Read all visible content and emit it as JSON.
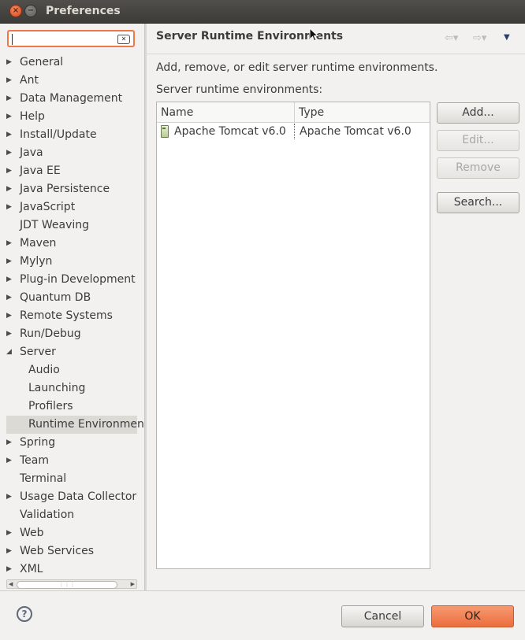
{
  "window": {
    "title": "Preferences"
  },
  "sidebar": {
    "search_placeholder": "",
    "items": [
      {
        "label": "General",
        "expander": "▶"
      },
      {
        "label": "Ant",
        "expander": "▶"
      },
      {
        "label": "Data Management",
        "expander": "▶"
      },
      {
        "label": "Help",
        "expander": "▶"
      },
      {
        "label": "Install/Update",
        "expander": "▶"
      },
      {
        "label": "Java",
        "expander": "▶"
      },
      {
        "label": "Java EE",
        "expander": "▶"
      },
      {
        "label": "Java Persistence",
        "expander": "▶"
      },
      {
        "label": "JavaScript",
        "expander": "▶"
      },
      {
        "label": "JDT Weaving",
        "expander": ""
      },
      {
        "label": "Maven",
        "expander": "▶"
      },
      {
        "label": "Mylyn",
        "expander": "▶"
      },
      {
        "label": "Plug-in Development",
        "expander": "▶"
      },
      {
        "label": "Quantum DB",
        "expander": "▶"
      },
      {
        "label": "Remote Systems",
        "expander": "▶"
      },
      {
        "label": "Run/Debug",
        "expander": "▶"
      },
      {
        "label": "Server",
        "expander": "◢"
      },
      {
        "label": "Audio",
        "expander": "",
        "child": true
      },
      {
        "label": "Launching",
        "expander": "",
        "child": true
      },
      {
        "label": "Profilers",
        "expander": "",
        "child": true
      },
      {
        "label": "Runtime Environmen",
        "expander": "",
        "child": true,
        "selected": true
      },
      {
        "label": "Spring",
        "expander": "▶"
      },
      {
        "label": "Team",
        "expander": "▶"
      },
      {
        "label": "Terminal",
        "expander": ""
      },
      {
        "label": "Usage Data Collector",
        "expander": "▶"
      },
      {
        "label": "Validation",
        "expander": ""
      },
      {
        "label": "Web",
        "expander": "▶"
      },
      {
        "label": "Web Services",
        "expander": "▶"
      },
      {
        "label": "XML",
        "expander": "▶"
      }
    ]
  },
  "page": {
    "title": "Server Runtime Environments",
    "description": "Add, remove, or edit server runtime environments.",
    "list_label": "Server runtime environments:",
    "table": {
      "columns": [
        "Name",
        "Type"
      ],
      "rows": [
        {
          "name": "Apache Tomcat v6.0",
          "type": "Apache Tomcat v6.0"
        }
      ]
    },
    "buttons": {
      "add": "Add...",
      "edit": "Edit...",
      "remove": "Remove",
      "search": "Search..."
    }
  },
  "footer": {
    "help": "?",
    "cancel": "Cancel",
    "ok": "OK"
  },
  "colors": {
    "accent": "#f07746",
    "ok_button": "#ec6d3e",
    "titlebar": "#3c3b37"
  }
}
